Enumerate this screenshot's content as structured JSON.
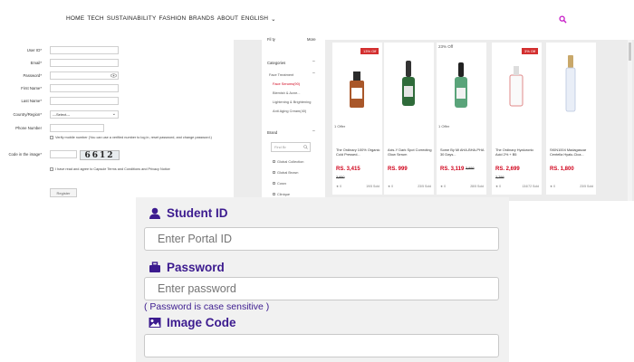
{
  "nav": {
    "links": [
      "HOME",
      "TECH",
      "SUSTAINABILITY",
      "FASHION",
      "BRANDS",
      "ABOUT",
      "ENGLISH"
    ],
    "dropdown_caret": "⌄"
  },
  "register_form": {
    "fields": [
      {
        "label": "User ID",
        "required": "*",
        "value": ""
      },
      {
        "label": "Email",
        "required": "*",
        "value": ""
      },
      {
        "label": "Password",
        "required": "*",
        "value": ""
      },
      {
        "label": "First Name",
        "required": "*",
        "value": ""
      },
      {
        "label": "Last Name",
        "required": "*",
        "value": ""
      }
    ],
    "country_label": "Country/Region",
    "country_required": "*",
    "country_value": "---Select---",
    "phone_label": "Phone Number",
    "verify_text": "Verify mobile number (You can use a verified number to log in, reset password, and change password.)",
    "code_label": "Code in the image",
    "code_required": "*",
    "captcha_text": "6612",
    "terms_text": "I have read and agree to Capsule Terms and Conditions and Privacy Notice",
    "register_button": "Register"
  },
  "shop": {
    "sidebar": {
      "sort_label": "Fil ty",
      "sort_value": "More",
      "categories_title": "Categories",
      "category_group": "Face Treatment",
      "category_items": [
        "Face Serums(90)",
        "Blemish & Acne...",
        "Lightening & Brightening",
        "Anti Aging Cream(40)"
      ],
      "brand_title": "Brand",
      "brand_search_placeholder": "Find Br",
      "brand_items": [
        "Global Collection",
        "Global Brown",
        "Cosrx",
        "Clinique"
      ]
    },
    "products": [
      {
        "badge": "13% Off",
        "offer": "1 Offer",
        "name": "The Ordinary 100% Organic Cold Pressed...",
        "price": "RS. 3,415",
        "old_price": "3,950",
        "rating": "0",
        "sold": "19/5 Sold"
      },
      {
        "badge": "",
        "offer": "",
        "name": "Axis-Y Dark Spot Correcting Glow Serum",
        "price": "RS. 999",
        "old_price": "",
        "rating": "0",
        "sold": "23/5 Sold"
      },
      {
        "badge": "23% Off",
        "offer": "1 Offer",
        "name": "Some By Mi AHA-BHA-PHA 30 Days...",
        "price": "RS. 3,119",
        "old_price": "3,999",
        "rating": "0",
        "sold": "28/5 Sold"
      },
      {
        "badge": "3% Off",
        "offer": "",
        "name": "The Ordinary Hyaluronic Acid 2% + B5",
        "price": "RS. 2,699",
        "old_price": "2,799",
        "rating": "0",
        "sold": "134/72 Sold"
      },
      {
        "badge": "",
        "offer": "",
        "name": "SKIN1004 Madagascar Centella Hyalu-Cica...",
        "price": "RS. 1,800",
        "old_price": "",
        "rating": "0",
        "sold": "23/5 Sold"
      }
    ]
  },
  "login": {
    "student_id_label": "Student ID",
    "student_id_placeholder": "Enter Portal ID",
    "password_label": "Password",
    "password_placeholder": "Enter password",
    "password_note": "( Password is case sensitive )",
    "image_code_label": "Image Code",
    "image_code_value": ""
  },
  "colors": {
    "accent_purple": "#3c1b8f",
    "nav_search": "#c516c5",
    "price_red": "#d0021b",
    "badge_red": "#d32f2f"
  }
}
